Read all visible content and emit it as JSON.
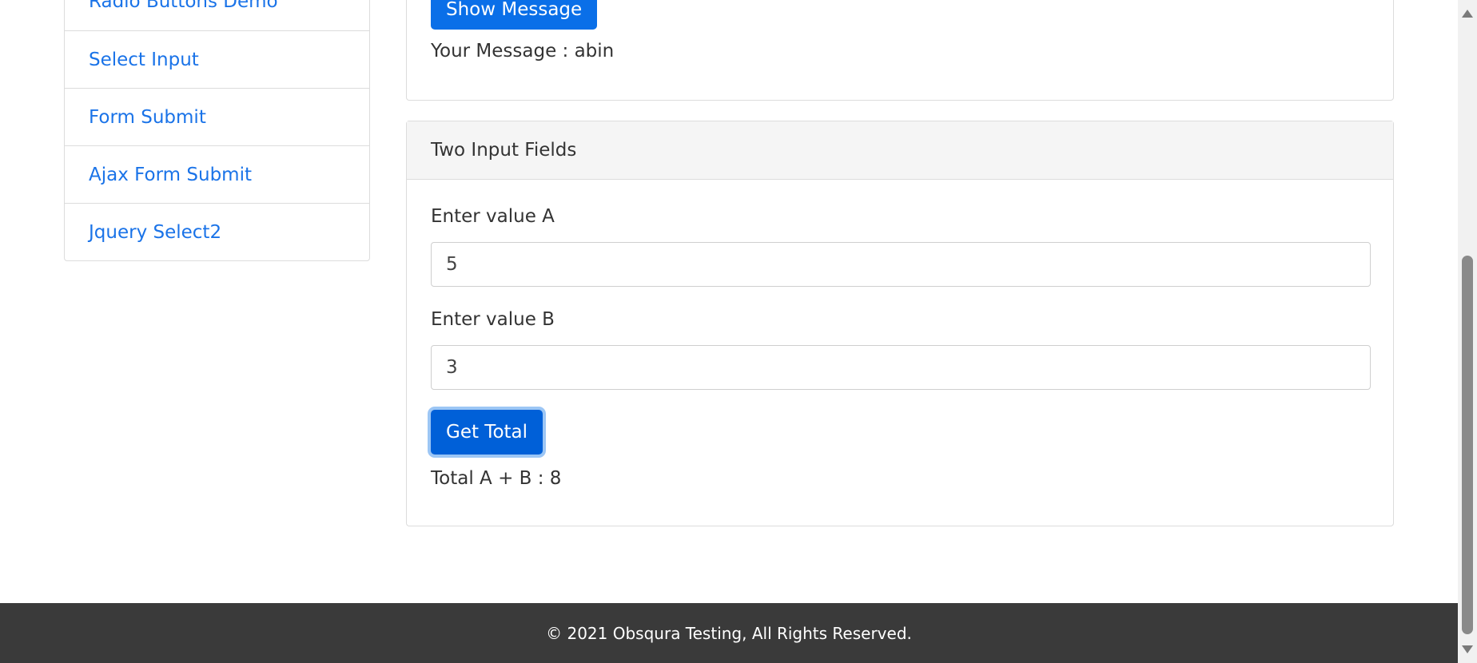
{
  "sidebar": {
    "items": [
      {
        "label": "Radio Buttons Demo"
      },
      {
        "label": "Select Input"
      },
      {
        "label": "Form Submit"
      },
      {
        "label": "Ajax Form Submit"
      },
      {
        "label": "Jquery Select2"
      }
    ]
  },
  "message_card": {
    "button_label": "Show Message",
    "message_text": "Your Message : abin"
  },
  "two_inputs_card": {
    "title": "Two Input Fields",
    "label_a": "Enter value A",
    "value_a": "5",
    "label_b": "Enter value B",
    "value_b": "3",
    "button_label": "Get Total",
    "total_text": "Total A + B : 8"
  },
  "footer": {
    "text": "© 2021 Obsqura Testing, All Rights Reserved."
  },
  "colors": {
    "link": "#1a73e8",
    "primary_button": "#0a6fe8",
    "footer_bg": "#3a3a3a"
  }
}
